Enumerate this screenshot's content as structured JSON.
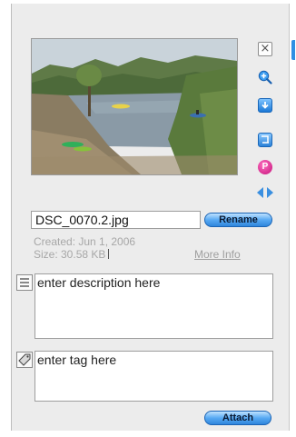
{
  "image": {
    "alt": "Photo of a river with kayakers, trees and grassy bank"
  },
  "toolbar": {
    "icons": [
      "close-icon",
      "zoom-in-icon",
      "download-icon",
      "crop-icon",
      "pin-icon",
      "left-right-arrows-icon"
    ],
    "pin_letter": "P",
    "close_glyph": "×"
  },
  "file": {
    "name": "DSC_0070.2.jpg",
    "rename_label": "Rename",
    "created": "Created: Jun 1, 2006",
    "size": "Size: 30.58 KB",
    "more_info": "More Info"
  },
  "description": {
    "placeholder": "enter description here"
  },
  "tags": {
    "placeholder": "enter tag here",
    "attach_label": "Attach"
  },
  "colors": {
    "accent": "#2f86dc",
    "panel": "#ececec",
    "muted_text": "#a7a7a7",
    "pin": "#c4127a"
  }
}
